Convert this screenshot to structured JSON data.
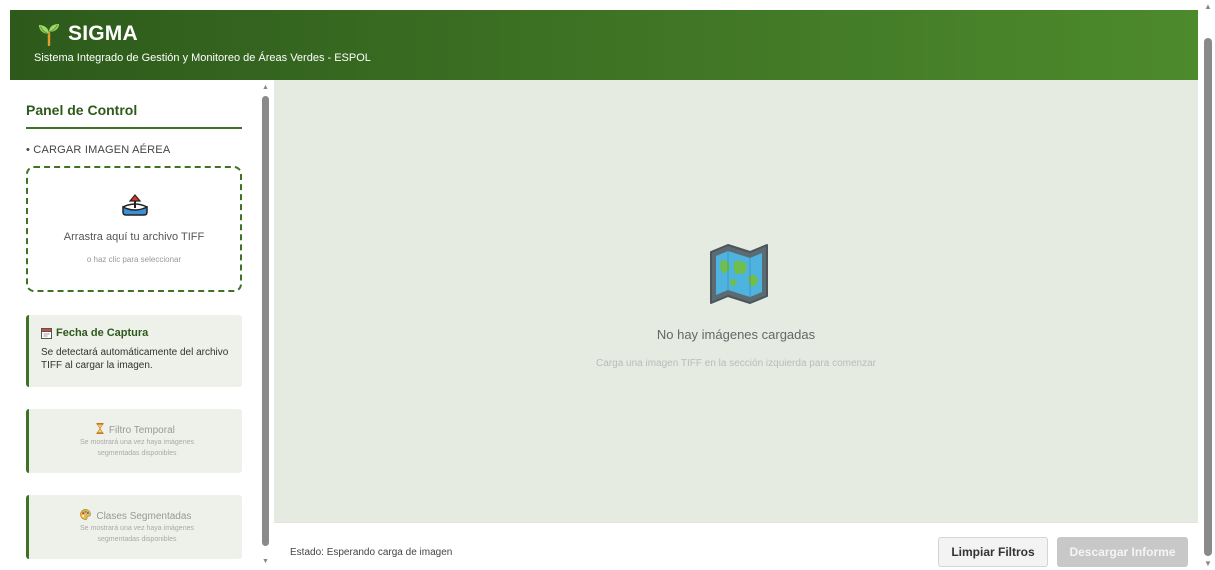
{
  "header": {
    "app_name": "SIGMA",
    "subtitle": "Sistema Integrado de Gestión y Monitoreo de Áreas Verdes - ESPOL",
    "logo_icon": "sprout-icon"
  },
  "sidebar": {
    "panel_title": "Panel de Control",
    "upload_section_label": "• CARGAR IMAGEN AÉREA",
    "dropzone": {
      "icon": "upload-icon",
      "main_text": "Arrastra aquí tu archivo TIFF",
      "hint_text": "o haz clic para seleccionar"
    },
    "capture_date": {
      "icon": "calendar-icon",
      "title": "Fecha de Captura",
      "description": "Se detectará automáticamente del archivo TIFF al cargar la imagen."
    },
    "temporal_filter": {
      "icon": "hourglass-icon",
      "title": "Filtro Temporal",
      "description": "Se mostrará una vez haya imágenes segmentadas disponibles"
    },
    "segmented_classes": {
      "icon": "palette-icon",
      "title": "Clases Segmentadas",
      "description": "Se mostrará una vez haya imágenes segmentadas disponibles"
    }
  },
  "main": {
    "empty_icon": "map-icon",
    "empty_title": "No hay imágenes cargadas",
    "empty_hint": "Carga una imagen TIFF en la sección izquierda para comenzar"
  },
  "statusbar": {
    "status_text": "Estado: Esperando carga de imagen",
    "clear_button": "Limpiar Filtros",
    "download_button": "Descargar Informe"
  },
  "colors": {
    "brand_dark": "#2d5a1b",
    "brand": "#3e7324",
    "main_bg": "#e6ebe1",
    "card_bg": "#eef0ea"
  }
}
